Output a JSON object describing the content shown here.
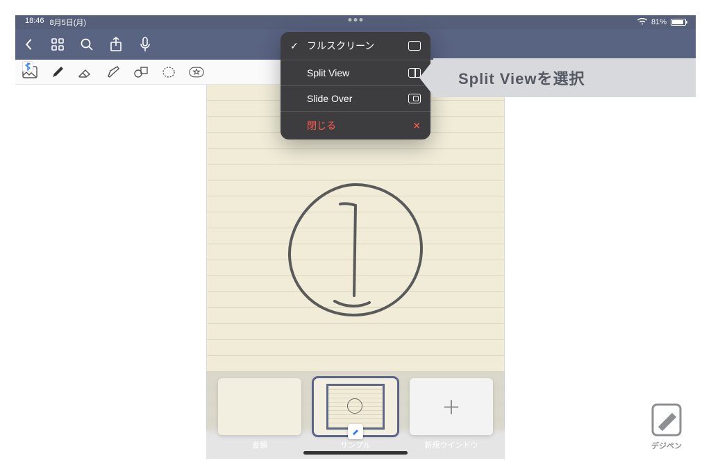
{
  "status": {
    "time": "18:46",
    "date": "8月5日(月)",
    "battery": "81%"
  },
  "popup": {
    "fullscreen": "フルスクリーン",
    "splitview": "Split View",
    "slideover": "Slide Over",
    "close": "閉じる"
  },
  "callout": "Split Viewを選択",
  "dock": {
    "item1": "書類",
    "item2": "サンプル",
    "item3": "新規ウインドウ",
    "plus": "＋"
  },
  "logo": "デジペン"
}
